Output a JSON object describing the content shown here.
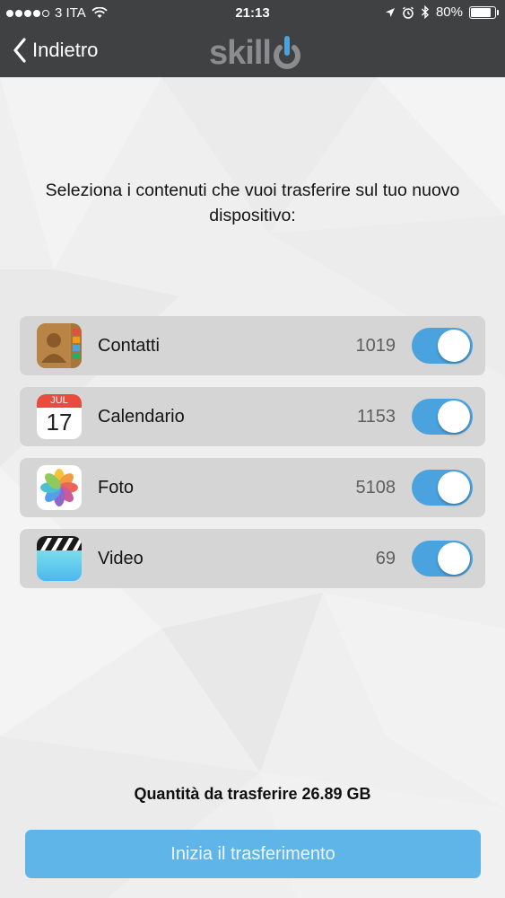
{
  "status_bar": {
    "carrier": "3 ITA",
    "time": "21:13",
    "battery": "80%",
    "battery_level": 0.8,
    "icons": [
      "signal-dots",
      "wifi-icon",
      "location-arrow-icon",
      "alarm-icon",
      "bluetooth-icon",
      "battery-icon"
    ]
  },
  "nav": {
    "back_label": "Indietro",
    "logo_text": "skill"
  },
  "prompt": "Seleziona i contenuti che vuoi trasferire sul tuo nuovo dispositivo:",
  "items": [
    {
      "label": "Contatti",
      "count": "1019",
      "icon": "contacts-app-icon",
      "enabled": true
    },
    {
      "label": "Calendario",
      "count": "1153",
      "icon": "calendar-app-icon",
      "enabled": true,
      "icon_month": "JUL",
      "icon_day": "17"
    },
    {
      "label": "Foto",
      "count": "5108",
      "icon": "photos-app-icon",
      "enabled": true
    },
    {
      "label": "Video",
      "count": "69",
      "icon": "videos-app-icon",
      "enabled": true
    }
  ],
  "summary": "Quantità da trasferire 26.89 GB",
  "cta_label": "Inizia il trasferimento",
  "colors": {
    "nav_bg": "#3f4142",
    "toggle_on": "#4aa3df",
    "button_bg": "#5fb5e8",
    "row_bg": "#d5d5d6"
  }
}
